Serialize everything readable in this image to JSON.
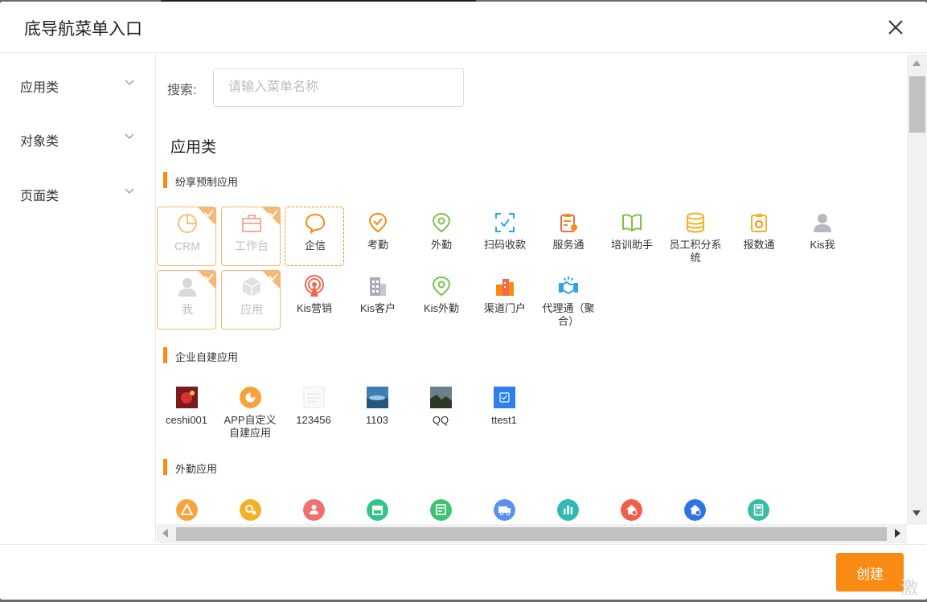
{
  "dialog": {
    "title": "底导航菜单入口"
  },
  "sidebar": {
    "items": [
      {
        "label": "应用类"
      },
      {
        "label": "对象类"
      },
      {
        "label": "页面类"
      }
    ]
  },
  "search": {
    "label": "搜索:",
    "placeholder": "请输入菜单名称",
    "value": ""
  },
  "section": {
    "title": "应用类"
  },
  "groups": [
    {
      "title": "纷享预制应用",
      "apps": [
        {
          "name": "CRM",
          "icon": "pie-chart-icon",
          "selected": true
        },
        {
          "name": "工作台",
          "icon": "briefcase-icon",
          "selected": true
        },
        {
          "name": "企信",
          "icon": "chat-bubble-icon",
          "selected": false,
          "focused": true
        },
        {
          "name": "考勤",
          "icon": "check-pin-icon",
          "selected": false
        },
        {
          "name": "外勤",
          "icon": "location-pin-icon",
          "selected": false
        },
        {
          "name": "扫码收款",
          "icon": "scan-icon",
          "selected": false
        },
        {
          "name": "服务通",
          "icon": "service-clipboard-icon",
          "selected": false
        },
        {
          "name": "培训助手",
          "icon": "book-icon",
          "selected": false
        },
        {
          "name": "员工积分系统",
          "icon": "coins-icon",
          "selected": false
        },
        {
          "name": "报数通",
          "icon": "report-clipboard-icon",
          "selected": false
        },
        {
          "name": "Kis我",
          "icon": "user-icon",
          "selected": false
        },
        {
          "name": "我",
          "icon": "user-icon",
          "selected": true
        },
        {
          "name": "应用",
          "icon": "cube-icon",
          "selected": true
        },
        {
          "name": "Kis营销",
          "icon": "broadcast-icon",
          "selected": false
        },
        {
          "name": "Kis客户",
          "icon": "buildings-icon",
          "selected": false
        },
        {
          "name": "Kis外勤",
          "icon": "location-pin-icon",
          "selected": false
        },
        {
          "name": "渠道门户",
          "icon": "city-icon",
          "selected": false
        },
        {
          "name": "代理通（聚合）",
          "icon": "handshake-icon",
          "selected": false
        }
      ]
    },
    {
      "title": "企业自建应用",
      "apps": [
        {
          "name": "ceshi001",
          "icon": "red-photo-thumb"
        },
        {
          "name": "APP自定义自建应用",
          "icon": "orange-pie-icon"
        },
        {
          "name": "123456",
          "icon": "blank-doc-thumb"
        },
        {
          "name": "1103",
          "icon": "sky-photo-thumb"
        },
        {
          "name": "QQ",
          "icon": "landscape-photo-thumb"
        },
        {
          "name": "ttest1",
          "icon": "blue-check-icon"
        }
      ]
    },
    {
      "title": "外勤应用",
      "apps": [
        {
          "name": "",
          "icon": "orange-triangle-icon",
          "color": "#f7a23a"
        },
        {
          "name": "",
          "icon": "yellow-pin-icon",
          "color": "#f5b126"
        },
        {
          "name": "",
          "icon": "red-people-icon",
          "color": "#f36f6f"
        },
        {
          "name": "",
          "icon": "green-store-icon",
          "color": "#34c48b"
        },
        {
          "name": "",
          "icon": "green-doc-icon",
          "color": "#3cc46e"
        },
        {
          "name": "",
          "icon": "blue-truck-icon",
          "color": "#5b8ff0"
        },
        {
          "name": "",
          "icon": "teal-chart-icon",
          "color": "#2fb8b5"
        },
        {
          "name": "",
          "icon": "red-home-icon",
          "color": "#f05d4a"
        },
        {
          "name": "",
          "icon": "blue-home-icon",
          "color": "#2f74e6"
        },
        {
          "name": "",
          "icon": "teal-calc-icon",
          "color": "#3bbca8"
        }
      ]
    }
  ],
  "footer": {
    "create_label": "创建"
  },
  "watermark": {
    "text": "激活"
  },
  "colors": {
    "accent": "#f98a14",
    "selected_border": "#f5b877"
  }
}
